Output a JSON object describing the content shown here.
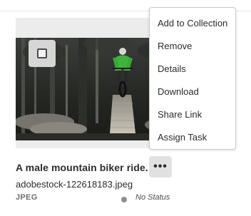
{
  "asset": {
    "title": "A male mountain biker ride...",
    "filename": "adobestock-122618183.jpeg",
    "filetype": "JPEG",
    "status": "No Status"
  },
  "more_button": {
    "label": "•••"
  },
  "context_menu": {
    "items": [
      {
        "label": "Add to Collection"
      },
      {
        "label": "Remove"
      },
      {
        "label": "Details"
      },
      {
        "label": "Download"
      },
      {
        "label": "Share Link"
      },
      {
        "label": "Assign Task"
      }
    ]
  },
  "colors": {
    "status_dot": "#8e8e8e",
    "menu_border": "#cacaca",
    "card_frame": "#ececec"
  }
}
